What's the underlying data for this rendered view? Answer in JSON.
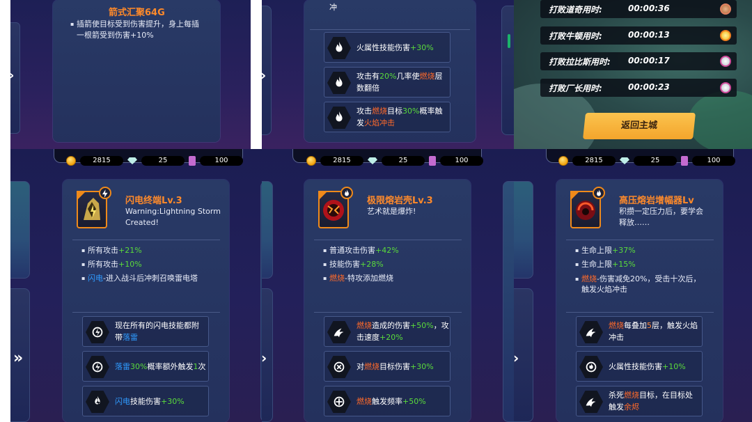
{
  "top_left": {
    "title": "箭式汇聚64G",
    "desc_line1": "插箭使目标受到伤害提升，身上每插",
    "desc_line2": "一根箭受到伤害+10%"
  },
  "top_middle": {
    "partial_text": "冲",
    "skills": [
      {
        "icon": "fire-icon",
        "p1": "火属性技能伤害",
        "p2": "+30%",
        "p3": "",
        "p4": "",
        "p5": "",
        "line2": ""
      },
      {
        "icon": "fire-icon",
        "p1": "攻击有",
        "p2": "20%",
        "p3": "几率使",
        "p4": "燃烧",
        "p5": "层",
        "line2": "数翻倍"
      },
      {
        "icon": "fire-icon",
        "p1": "攻击",
        "p2": "燃烧",
        "p3": "目标",
        "p4": "30%",
        "p5": "概率触",
        "line2a": "发",
        "line2b": "火焰冲击"
      }
    ]
  },
  "results": {
    "rows": [
      {
        "label": "打败道奇用时:",
        "time": "00:00:36",
        "medal": "bronze-medal-icon"
      },
      {
        "label": "打败牛顿用时:",
        "time": "00:00:13",
        "medal": "gold-medal-icon"
      },
      {
        "label": "打败拉比斯用时:",
        "time": "00:00:17",
        "medal": "silver-medal-icon"
      },
      {
        "label": "打败厂长用时:",
        "time": "00:00:23",
        "medal": "silver-medal-icon"
      }
    ],
    "return_button": "返回主城"
  },
  "currency": {
    "coins": "2815",
    "gems": "25",
    "tickets": "100"
  },
  "panel_lightning": {
    "title": "闪电终端Lv.3",
    "subtitle_line1": "Warning:Lightning Storm",
    "subtitle_line2": "Created!",
    "bullets": [
      {
        "a": "所有攻击",
        "b": "+21%",
        "c": ""
      },
      {
        "a": "所有攻击",
        "b": "+10%",
        "c": ""
      },
      {
        "a": "闪电",
        "b": "-进入战斗后冲刺召唤雷电塔",
        "c": ""
      }
    ],
    "skills": [
      {
        "l1": "现在所有的闪电技能都附",
        "l2a": "带",
        "l2b": "落雷"
      },
      {
        "a": "落雷",
        "b": "30%",
        "c": "概率额外触发",
        "d": "1",
        "e": "次"
      },
      {
        "a": "闪电",
        "b": "技能伤害",
        "c": "+30%"
      }
    ]
  },
  "panel_lava": {
    "title": "极限熔岩壳Lv.3",
    "subtitle": "艺术就是爆炸!",
    "bullets": [
      {
        "a": "普通攻击伤害",
        "b": "+42%"
      },
      {
        "a": "技能伤害",
        "b": "+28%"
      },
      {
        "a": "燃烧",
        "b": "-特攻添加燃烧"
      }
    ],
    "skills": [
      {
        "a": "燃烧",
        "b": "造成的伤害",
        "c": "+50%",
        "d": "，攻",
        "l2a": "击速度",
        "l2b": "+20%"
      },
      {
        "a": "对",
        "b": "燃烧",
        "c": "目标伤害",
        "d": "+30%"
      },
      {
        "a": "燃烧",
        "b": "触发频率",
        "c": "+50%"
      }
    ]
  },
  "panel_pressure": {
    "title": "高压熔岩增幅器Lv",
    "subtitle_line1": "积攒一定压力后，要学会",
    "subtitle_line2": "释放……",
    "bullets": [
      {
        "a": "生命上限",
        "b": "+37%"
      },
      {
        "a": "生命上限",
        "b": "+15%"
      },
      {
        "a": "燃烧",
        "b": "-伤害减免20%，受击十次后，",
        "l2": "触发火焰冲击"
      }
    ],
    "skills": [
      {
        "a": "燃烧",
        "b": "每叠加",
        "c": "5",
        "d": "层，触发火焰",
        "l2": "冲击"
      },
      {
        "a": "火属性技能伤害",
        "b": "+10%"
      },
      {
        "a": "杀死",
        "b": "燃烧",
        "c": "目标，在目标处",
        "l2a": "触发",
        "l2b": "余烬"
      }
    ]
  },
  "colors": {
    "bonus_green": "#5bdc3b",
    "burn_orange": "#ff6a2a",
    "lightning_blue": "#2f9bff",
    "title_orange": "#ff8a2a",
    "return_button": "#f7b13a"
  }
}
